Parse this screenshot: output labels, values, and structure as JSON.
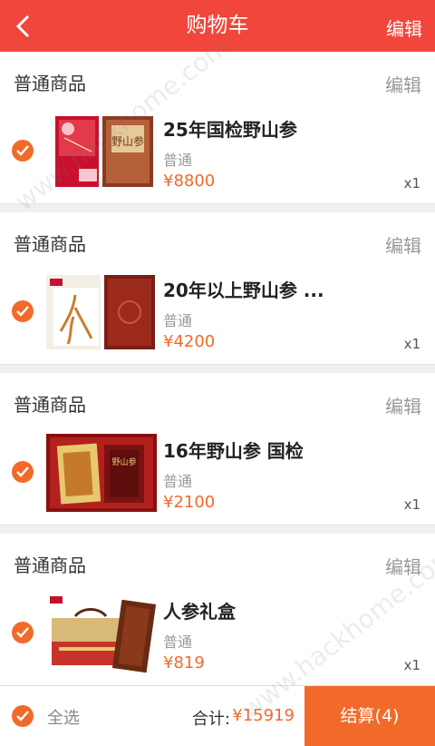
{
  "header": {
    "title": "购物车",
    "edit_label": "编辑"
  },
  "items": [
    {
      "section": "普通商品",
      "section_edit": "编辑",
      "name": "25年国检野山参",
      "type": "普通",
      "price": "¥8800",
      "qty": "x1",
      "image": "ginseng-gift-box-red"
    },
    {
      "section": "普通商品",
      "section_edit": "编辑",
      "name": "20年以上野山参 ...",
      "type": "普通",
      "price": "¥4200",
      "qty": "x1",
      "image": "ginseng-box-open-wood"
    },
    {
      "section": "普通商品",
      "section_edit": "编辑",
      "name": "16年野山参 国检",
      "type": "普通",
      "price": "¥2100",
      "qty": "x1",
      "image": "ginseng-gold-case"
    },
    {
      "section": "普通商品",
      "section_edit": "编辑",
      "name": "人参礼盒",
      "type": "普通",
      "price": "¥819",
      "qty": "x1",
      "image": "ginseng-gift-set"
    }
  ],
  "footer": {
    "select_all": "全选",
    "total_label": "合计:",
    "total_value": "¥15919",
    "checkout_label": "结算(4)"
  },
  "watermark": "www.hackhome.com",
  "colors": {
    "header": "#f0463b",
    "accent": "#f26a2a"
  }
}
